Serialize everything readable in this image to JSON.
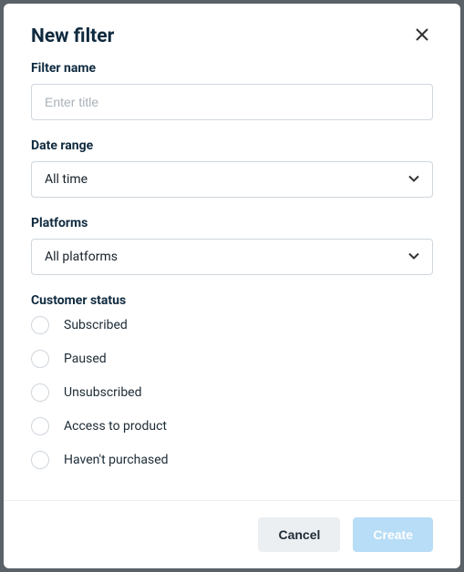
{
  "modal": {
    "title": "New filter",
    "fields": {
      "filter_name": {
        "label": "Filter name",
        "placeholder": "Enter title",
        "value": ""
      },
      "date_range": {
        "label": "Date range",
        "selected": "All time"
      },
      "platforms": {
        "label": "Platforms",
        "selected": "All platforms"
      },
      "customer_status": {
        "label": "Customer status",
        "options": [
          "Subscribed",
          "Paused",
          "Unsubscribed",
          "Access to product",
          "Haven't purchased"
        ]
      }
    },
    "buttons": {
      "cancel": "Cancel",
      "create": "Create"
    }
  }
}
